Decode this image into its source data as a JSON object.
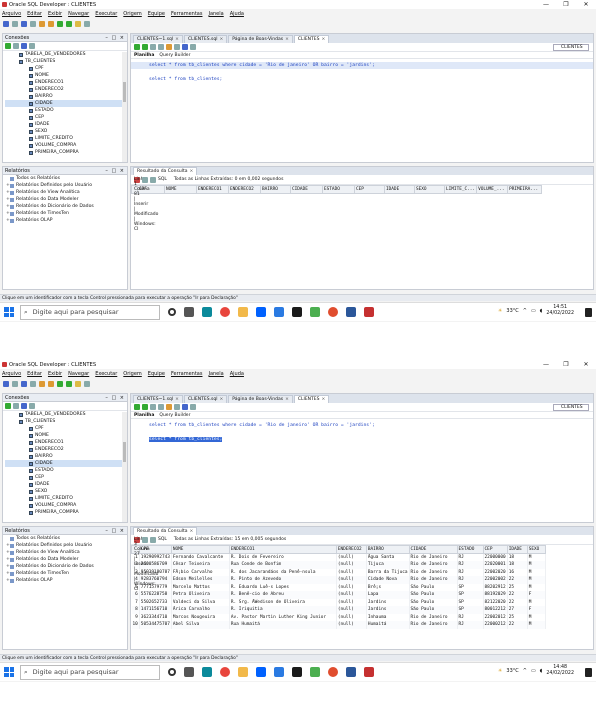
{
  "window": {
    "title": "Oracle SQL Developer : CLIENTES",
    "controls": [
      "—",
      "❐",
      "✕"
    ]
  },
  "menu": [
    "Arquivo",
    "Editar",
    "Exibir",
    "Navegar",
    "Executar",
    "Origem",
    "Equipe",
    "Ferramentas",
    "Janela",
    "Ajuda"
  ],
  "connections": {
    "title": "Conexões",
    "tree": [
      "TABELA_DE_VENDEDORES",
      "TB_CLIENTES",
      "CPF",
      "NOME",
      "ENDERECO1",
      "ENDERECO2",
      "BAIRRO",
      "CIDADE",
      "ESTADO",
      "CEP",
      "IDADE",
      "SEXO",
      "LIMITE_CREDITO",
      "VOLUME_COMPRA",
      "PRIMEIRA_COMPRA"
    ]
  },
  "reports": {
    "title": "Relatórios",
    "items": [
      "Todos os Relatórios",
      "Relatórios Definidos pelo Usuário",
      "Relatórios de View Analítica",
      "Relatórios do Data Modeler",
      "Relatórios do Dicionário de Dados",
      "Relatórios de TimesTen",
      "Relatórios OLAP"
    ]
  },
  "editor": {
    "tabs": [
      "CLIENTES~1.sql",
      "CLIENTES.sql",
      "Página de Boas-Vindas",
      "CLIENTES"
    ],
    "connection": "CLIENTES",
    "subtabs": [
      "Planilha",
      "Query Builder"
    ],
    "line1": "select * from tb_clientes where cidade = 'Rio de janeiro' OR bairro = 'jardins';",
    "line2": "select * from tb_clientes;"
  },
  "result": {
    "tab": "Resultado da Consulta",
    "sql_label": "SQL",
    "msg1": "Todas as Linhas Extraídas: 0 em 0,002 segundos",
    "msg2": "Todas as Linhas Extraídas: 15 em 0,005 segundos",
    "cols1": [
      "CPF",
      "NOME",
      "ENDERECO1",
      "ENDERECO2",
      "BAIRRO",
      "CIDADE",
      "ESTADO",
      "CEP",
      "IDADE",
      "SEXO",
      "LIMITE_C...",
      "VOLUME_...",
      "PRIMEIRA..."
    ],
    "cols2": [
      "CPF",
      "NOME",
      "ENDERECO1",
      "ENDERECO2",
      "BAIRRO",
      "CIDADE",
      "ESTADO",
      "CEP",
      "IDADE",
      "SEXO"
    ],
    "rows": [
      [
        "1",
        "19290992743",
        "Fernando Cavalcante",
        "R. Dois de Fevereiro",
        "(null)",
        "Ãgua Santa",
        "Rio de Janeiro",
        "RJ",
        "22000000",
        "18",
        "M"
      ],
      [
        "2",
        "2600586709",
        "Cêsar Teixeira",
        "Rua Conde de Bonfim",
        "(null)",
        "Tijuca",
        "Rio de Janeiro",
        "RJ",
        "22020001",
        "18",
        "M"
      ],
      [
        "3",
        "95939180787",
        "FÃ¡bio Carvalho",
        "R. dos Jacarandáɑs da Penê-nsula",
        "(null)",
        "Barra da Tijuca",
        "Rio de Janeiro",
        "RJ",
        "22002020",
        "16",
        "M"
      ],
      [
        "4",
        "9283760794",
        "Edson Meilelles",
        "R. Pinto de Azevedo",
        "(null)",
        "Cidade Nova",
        "Rio de Janeiro",
        "RJ",
        "22002002",
        "22",
        "M"
      ],
      [
        "5",
        "7771579779",
        "Marcelo Mattos",
        "R. Eduardo Luê-s Lopes",
        "(null)",
        "Brê¡s",
        "São Paulo",
        "SP",
        "88202912",
        "25",
        "M"
      ],
      [
        "6",
        "5576228758",
        "Petra Oliveira",
        "R. Benê-cio de Abreu",
        "(null)",
        "Lapa",
        "São Paulo",
        "SP",
        "88192029",
        "22",
        "F"
      ],
      [
        "7",
        "5502652733",
        "Valdeci da Silva",
        "R. Srg. ÃWedison de Oliveira",
        "(null)",
        "Jardins",
        "São Paulo",
        "SP",
        "82122020",
        "22",
        "M"
      ],
      [
        "8",
        "1471156710",
        "Ãrica Carvalho",
        "R. Iriquitia",
        "(null)",
        "Jardins",
        "São Paulo",
        "SP",
        "80012212",
        "27",
        "F"
      ],
      [
        "9",
        "3623344710",
        "Marcos Nougeuira",
        "Av. Pastor Martin Luther King Junior",
        "(null)",
        "Inhauma",
        "Rio de Janeiro",
        "RJ",
        "22002012",
        "25",
        "M"
      ],
      [
        "10",
        "50534475707",
        "Abel Silva",
        "Rua Humaitá",
        "(null)",
        "Humaitá",
        "Rio de Janeiro",
        "RJ",
        "22000212",
        "22",
        "M"
      ]
    ]
  },
  "status": {
    "hint": "Clique em um identificador com a tecla Control pressionada para executar a operação \"Ir para Declaração\"",
    "right1": "Linha 1 Coluna 81 | Inserir | Modificado | Windows: CI",
    "right2": "Linha 3 Coluna 27 | Inserir | Modificado | Windows: CI"
  },
  "taskbar": {
    "search_placeholder": "Digite aqui para pesquisar",
    "weather": "33°C",
    "time1": "14:51",
    "time2": "14:48",
    "date": "24/02/2022"
  },
  "colors": {
    "accent": "#3367d6",
    "start": "#1a73e8"
  }
}
